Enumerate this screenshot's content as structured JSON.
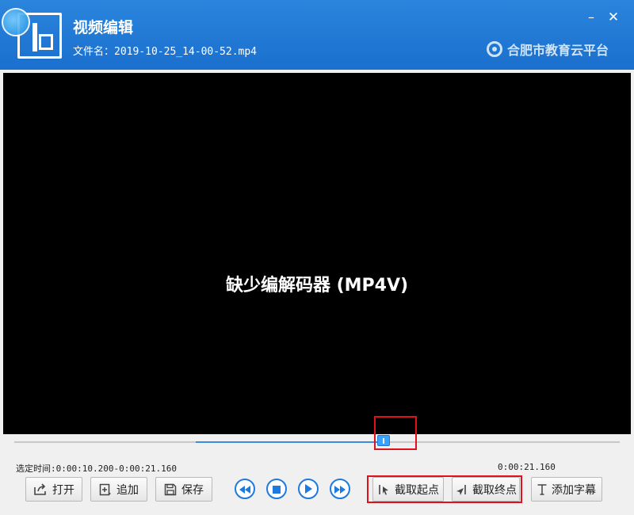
{
  "window": {
    "title": "视频编辑",
    "file_label": "文件名：2019-10-25_14-00-52.mp4",
    "brand": "合肥市教育云平台",
    "minimize_glyph": "–",
    "close_glyph": "✕"
  },
  "video": {
    "message": "缺少编解码器 (MP4V)"
  },
  "timeline": {
    "selection_start_fraction": 0.3,
    "selection_end_fraction": 0.61
  },
  "info": {
    "selected_time": "选定时间:0:00:10.200-0:00:21.160",
    "duration": "0:00:21.160"
  },
  "toolbar": {
    "open_label": "打开",
    "append_label": "追加",
    "save_label": "保存",
    "set_start_label": "截取起点",
    "set_end_label": "截取终点",
    "add_subtitle_label": "添加字幕"
  },
  "icons": {
    "open": "open-icon",
    "append": "append-icon",
    "save": "save-icon",
    "rewind": "rewind-icon",
    "stop": "stop-icon",
    "play": "play-icon",
    "fast_forward": "fast-forward-icon",
    "set_start": "cut-start-icon",
    "set_end": "cut-end-icon",
    "subtitle": "text-icon"
  },
  "colors": {
    "title_bar": "#1b6fce",
    "accent": "#1e7ae0",
    "highlight": "#e0101c"
  }
}
